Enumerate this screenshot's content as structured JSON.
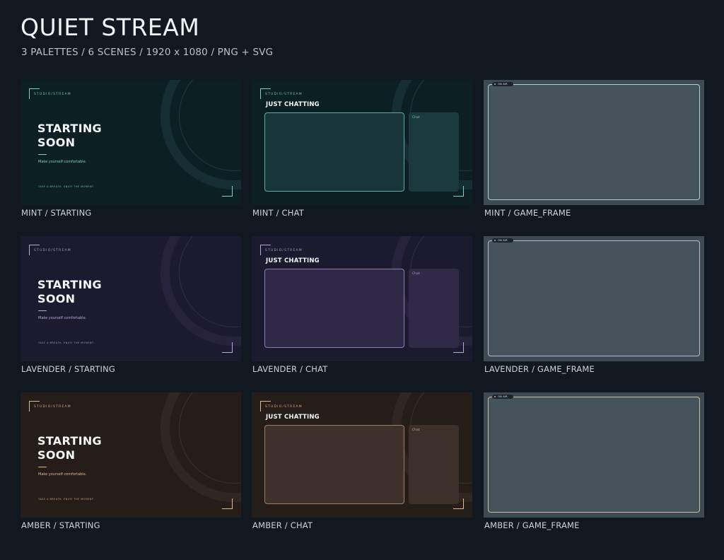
{
  "header": {
    "title": "QUIET STREAM",
    "subtitle": "3 PALETTES / 6 SCENES / 1920 x 1080 / PNG + SVG"
  },
  "scene_text": {
    "brand": "STUDIO/STREAM",
    "starting_line1": "STARTING",
    "starting_line2": "SOON",
    "starting_sub": "Make yourself comfortable.",
    "starting_foot": "TAKE A BREATH. ENJOY THE MOMENT.",
    "chat_title": "JUST CHATTING",
    "chat_label": "Chat",
    "pill_label": "ON AIR"
  },
  "palettes": [
    {
      "colors": {
        "bg": "#0c2024",
        "ring": "#1b3b3f",
        "ring_line": "#2f5459",
        "accent": "#7dd3c0",
        "panel": "#183539",
        "panel_border": "#5fa9a0",
        "side": "#1a3a3e",
        "frame_border": "#9ed8cf"
      },
      "captions": {
        "starting": "MINT / STARTING",
        "chat": "MINT / CHAT",
        "game_frame": "MINT / GAME_FRAME"
      }
    },
    {
      "colors": {
        "bg": "#1c1a2e",
        "ring": "#2f2a47",
        "ring_line": "#443d60",
        "accent": "#b8a6e6",
        "panel": "#2f2947",
        "panel_border": "#8b7cb8",
        "side": "#302a48",
        "frame_border": "#b9b2dc"
      },
      "captions": {
        "starting": "LAVENDER / STARTING",
        "chat": "LAVENDER / CHAT",
        "game_frame": "LAVENDER / GAME_FRAME"
      }
    },
    {
      "colors": {
        "bg": "#241d1a",
        "ring": "#3d2f29",
        "ring_line": "#54443c",
        "accent": "#e0b98a",
        "panel": "#3f312b",
        "panel_border": "#9c7f63",
        "side": "#3c302b",
        "frame_border": "#cdbba6"
      },
      "captions": {
        "starting": "AMBER / STARTING",
        "chat": "AMBER / CHAT",
        "game_frame": "AMBER / GAME_FRAME"
      }
    }
  ]
}
